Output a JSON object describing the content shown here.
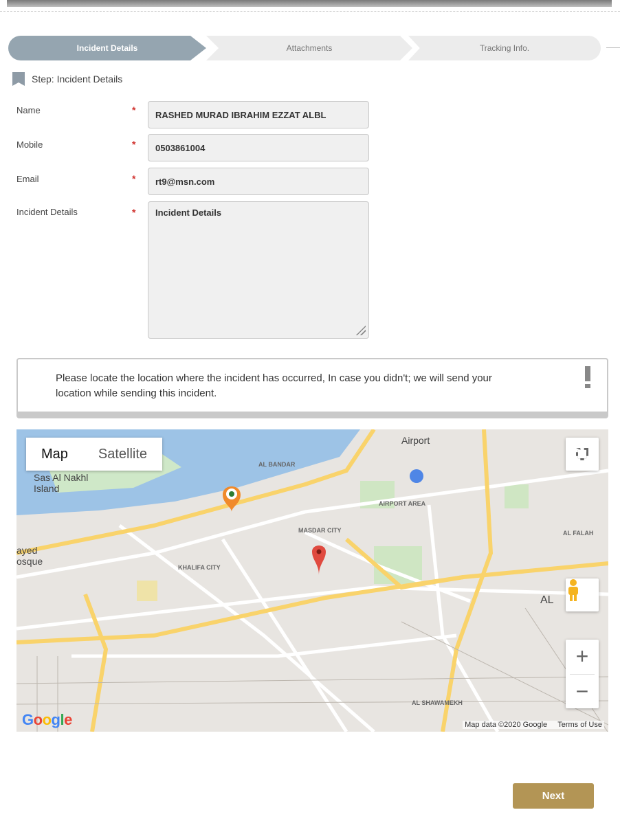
{
  "steps": [
    {
      "label": "Incident Details"
    },
    {
      "label": "Attachments"
    },
    {
      "label": "Tracking Info."
    }
  ],
  "step_title": "Step: Incident Details",
  "form": {
    "name_label": "Name",
    "name_value": "RASHED MURAD IBRAHIM EZZAT ALBL",
    "mobile_label": "Mobile",
    "mobile_value": "0503861004",
    "email_label": "Email",
    "email_value": "rt9@msn.com",
    "details_label": "Incident Details",
    "details_placeholder": "Incident Details",
    "required_mark": "*"
  },
  "notice": "Please locate the location where the incident has occurred, In case you didn't; we will send your location while sending this incident.",
  "map": {
    "type_map": "Map",
    "type_satellite": "Satellite",
    "zoom_in": "+",
    "zoom_out": "−",
    "attribution": "Map data ©2020 Google",
    "terms": "Terms of Use",
    "labels": {
      "airport": "Airport",
      "airport_area": "AIRPORT AREA",
      "al_bandar": "AL BANDAR",
      "masdar_city": "MASDAR CITY",
      "khalifa_city": "KHALIFA CITY",
      "al_falah": "AL FALAH",
      "al_shawamekh": "AL SHAWAMEKH",
      "sas_al_nakhl": "Sas Al Nakhl Island",
      "ayed_mosque": "ayed osque",
      "al_right": "AL"
    }
  },
  "colors": {
    "active_step": "#95a5b0",
    "required": "#d0312d",
    "next_button": "#b39555"
  },
  "next_label": "Next"
}
